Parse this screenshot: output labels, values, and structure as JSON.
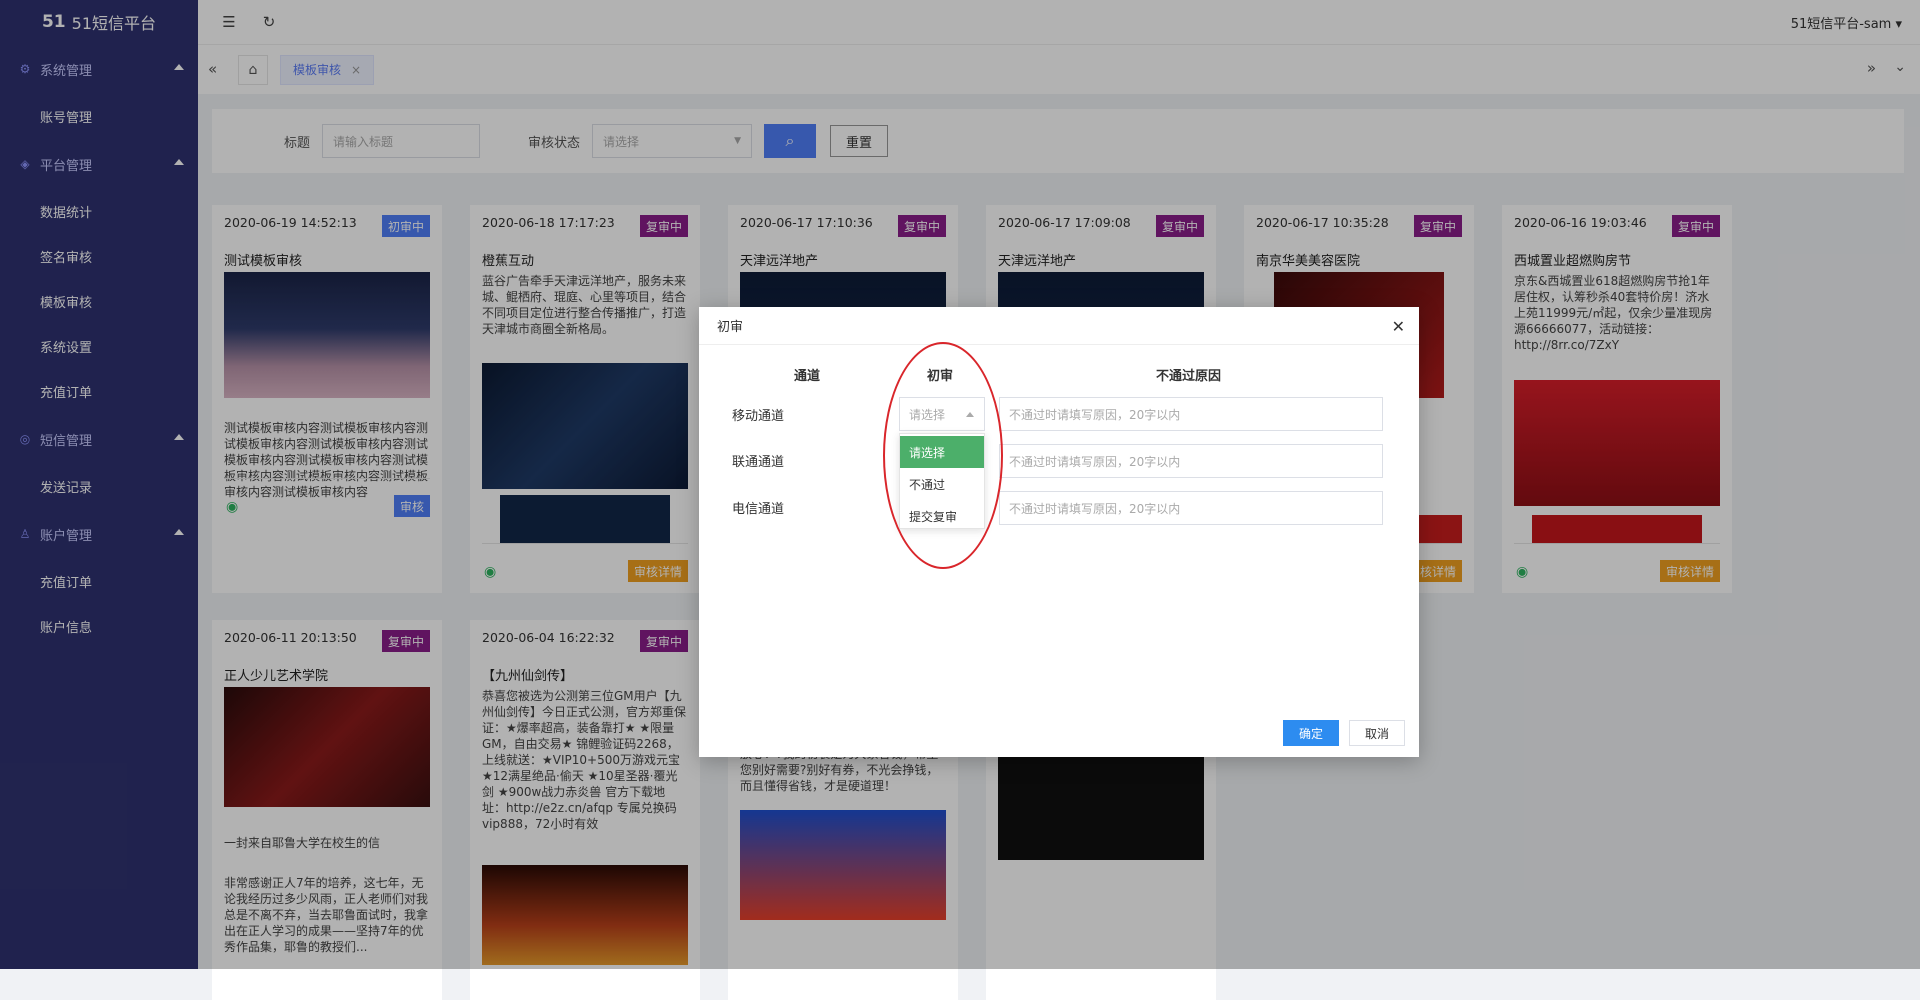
{
  "app": {
    "logo_mark": "51",
    "title": "51短信平台",
    "user": "51短信平台-sam"
  },
  "sidebar": {
    "groups": [
      {
        "label": "系统管理",
        "icon": "gear-icon",
        "items": [
          "账号管理"
        ]
      },
      {
        "label": "平台管理",
        "icon": "cube-icon",
        "items": [
          "数据统计",
          "签名审核",
          "模板审核",
          "系统设置",
          "充值订单"
        ]
      },
      {
        "label": "短信管理",
        "icon": "chat-icon",
        "items": [
          "发送记录"
        ]
      },
      {
        "label": "账户管理",
        "icon": "user-icon",
        "items": [
          "充值订单",
          "账户信息"
        ]
      }
    ]
  },
  "tabs": {
    "active": "模板审核"
  },
  "filter": {
    "title_label": "标题",
    "title_placeholder": "请输入标题",
    "status_label": "审核状态",
    "status_placeholder": "请选择",
    "reset": "重置"
  },
  "cards": [
    {
      "date": "2020-06-19 14:52:13",
      "badge": "初审中",
      "badge_color": "blue",
      "title": "测试模板审核",
      "body": "测试模板审核内容测试模板审核内容测试模板审核内容测试模板审核内容测试模板审核内容测试模板审核内容测试模板审核内容测试模板审核内容测试模板审核内容测试模板审核内容",
      "action": "审核",
      "action_color": "blue"
    },
    {
      "date": "2020-06-18 17:17:23",
      "badge": "复审中",
      "badge_color": "purple",
      "title": "橙蕉互动",
      "body": "蓝谷广告牵手天津远洋地产，服务未来城、鲲栖府、琨庭、心里等项目，结合不同项目定位进行整合传播推广，打造天津城市商圈全新格局。",
      "action": "审核详情",
      "action_color": "orange"
    },
    {
      "date": "2020-06-17 17:10:36",
      "badge": "复审中",
      "badge_color": "purple",
      "title": "天津远洋地产"
    },
    {
      "date": "2020-06-17 17:09:08",
      "badge": "复审中",
      "badge_color": "purple",
      "title": "天津远洋地产"
    },
    {
      "date": "2020-06-17 10:35:28",
      "badge": "复审中",
      "badge_color": "purple",
      "title": "南京华美美容医院",
      "action": "审核详情",
      "action_color": "orange"
    },
    {
      "date": "2020-06-16 19:03:46",
      "badge": "复审中",
      "badge_color": "purple",
      "title": "西城置业超燃购房节",
      "body": "京东&西城置业618超燃购房节抢1年居住权，认筹秒杀40套特价房！济水上苑11999元/㎡起，仅余少量准现房源66666077，活动链接：http://8rr.co/7ZxY",
      "action": "审核详情",
      "action_color": "orange"
    },
    {
      "date": "2020-06-11 20:13:50",
      "badge": "复审中",
      "badge_color": "purple",
      "title": "正人少儿艺术学院",
      "body": "一封来自耶鲁大学在校生的信",
      "body2": "非常感谢正人7年的培养，这七年，无论我经历过多少风雨，正人老师们对我总是不离不弃，当去耶鲁面试时，我拿出在正人学习的成果——坚持7年的优秀作品集，耶鲁的教授们..."
    },
    {
      "date": "2020-06-04 16:22:32",
      "badge": "复审中",
      "badge_color": "purple",
      "title": "【九州仙剑传】",
      "body": "恭喜您被选为公测第三位GM用户【九州仙剑传】今日正式公测，官方郑重保证：★爆率超高，装备靠打★ ★限量 GM，自由交易★ 锦鲤验证码2268，上线就送：★VIP10+500万游戏元宝 ★12满星绝品·偷天 ★10星圣器·覆光剑 ★900w战力赤炎兽 官方下载地址：http://e2z.cn/afqp 专属兑换码vip888，72小时有效"
    },
    {
      "body": "...，自信都是来信自句以直到的，大家放心！?我的初衷是为大家省钱，希望您别好需要?别好有券，不光会挣钱，而且懂得省钱，才是硬道理！"
    }
  ],
  "dialog": {
    "title": "初审",
    "col_channel": "通道",
    "col_review": "初审",
    "col_reason": "不通过原因",
    "rows": [
      {
        "channel": "移动通道",
        "reason_placeholder": "不通过时请填写原因，20字以内"
      },
      {
        "channel": "联通通道",
        "reason_placeholder": "不通过时请填写原因，20字以内"
      },
      {
        "channel": "电信通道",
        "reason_placeholder": "不通过时请填写原因，20字以内"
      }
    ],
    "select_placeholder": "请选择",
    "options": [
      "请选择",
      "不通过",
      "提交复审"
    ],
    "ok": "确定",
    "cancel": "取消"
  },
  "colors": {
    "sidebar": "#2f3270",
    "primary": "#4f7ef8",
    "purple_badge": "#8a1d8a",
    "orange": "#f0a020",
    "selected_option": "#4caf6a",
    "highlight_ring": "#d9262b"
  }
}
